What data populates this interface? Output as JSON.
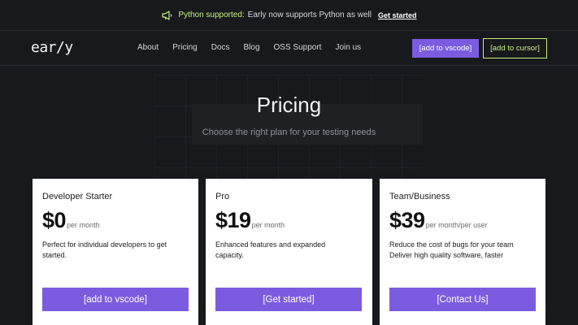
{
  "announcement": {
    "icon": "megaphone-icon",
    "highlight": "Python supported:",
    "text": "Early now supports Python as well",
    "cta": "Get started"
  },
  "nav": {
    "logo": "ear/y",
    "links": [
      "About",
      "Pricing",
      "Docs",
      "Blog",
      "OSS Support",
      "Join us"
    ],
    "vscode_button": "[add to vscode]",
    "cursor_button": "[add to cursor]"
  },
  "hero": {
    "title": "Pricing",
    "subtitle": "Choose the right plan for your testing needs"
  },
  "plans": [
    {
      "name": "Developer Starter",
      "price": "$0",
      "period": "per month",
      "description": "Perfect for individual developers to get started.",
      "cta": "[add to vscode]"
    },
    {
      "name": "Pro",
      "price": "$19",
      "period": "per month",
      "description": "Enhanced features and expanded capacity.",
      "cta": "[Get started]"
    },
    {
      "name": "Team/Business",
      "price": "$39",
      "period": "per month/per user",
      "description": "Reduce the cost of bugs for your team Deliver high quality software, faster",
      "cta": "[Contact Us]"
    }
  ],
  "colors": {
    "background": "#17191d",
    "accent_purple": "#7b5ce0",
    "accent_lime": "#c6f07a",
    "card": "#ffffff"
  }
}
